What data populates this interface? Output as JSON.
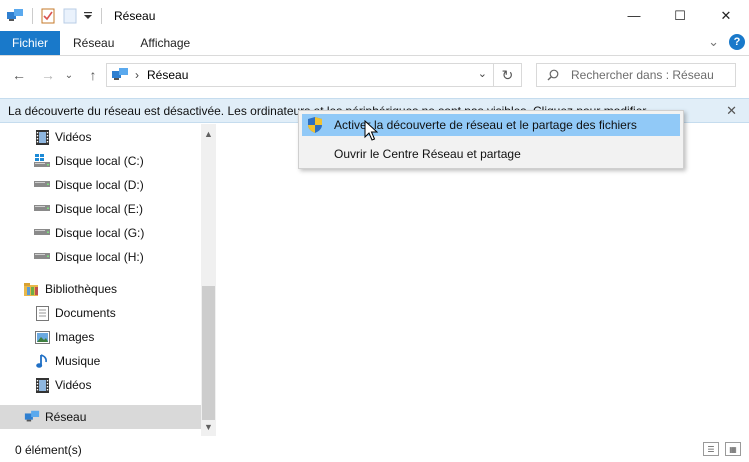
{
  "window": {
    "title": "Réseau",
    "minimize_glyph": "—",
    "maximize_glyph": "☐",
    "close_glyph": "✕"
  },
  "ribbon": {
    "tabs": [
      "Fichier",
      "Réseau",
      "Affichage"
    ],
    "expand_glyph": "⌄",
    "help_glyph": "?"
  },
  "navbar": {
    "back_glyph": "←",
    "forward_glyph": "→",
    "recent_glyph": "⌄",
    "up_glyph": "↑",
    "breadcrumb_separator": "›",
    "address": "Réseau",
    "address_dropdown_glyph": "⌄",
    "refresh_glyph": "↻",
    "search_placeholder": "Rechercher dans : Réseau",
    "search_glyph": "⚲"
  },
  "infobar": {
    "message": "La découverte du réseau est désactivée. Les ordinateurs et les périphériques ne sont pas visibles. Cliquez pour modifier...",
    "close_glyph": "✕"
  },
  "nav_pane": {
    "items": [
      {
        "label": "Vidéos",
        "icon": "video-icon"
      },
      {
        "label": "Disque local  (C:)",
        "icon": "windows-drive-icon"
      },
      {
        "label": "Disque local (D:)",
        "icon": "drive-icon"
      },
      {
        "label": "Disque local (E:)",
        "icon": "drive-icon"
      },
      {
        "label": "Disque local (G:)",
        "icon": "drive-icon"
      },
      {
        "label": "Disque local (H:)",
        "icon": "drive-icon"
      },
      {
        "label": "Bibliothèques",
        "icon": "libraries-icon"
      },
      {
        "label": "Documents",
        "icon": "documents-icon"
      },
      {
        "label": "Images",
        "icon": "pictures-icon"
      },
      {
        "label": "Musique",
        "icon": "music-icon"
      },
      {
        "label": "Vidéos",
        "icon": "video-icon"
      },
      {
        "label": "Réseau",
        "icon": "network-icon",
        "selected": true
      }
    ],
    "scroll_up_glyph": "▲",
    "scroll_down_glyph": "▼"
  },
  "context_menu": {
    "items": [
      {
        "label": "Activer la découverte de réseau et le partage des fichiers",
        "highlighted": true,
        "icon": "uac-shield-icon"
      },
      {
        "label": "Ouvrir le Centre Réseau et partage",
        "highlighted": false
      }
    ]
  },
  "status": {
    "item_count": "0 élément(s)"
  },
  "colors": {
    "accent": "#1979ca",
    "infobar_bg": "#e1eef8",
    "menu_highlight": "#91c9f7",
    "selected_item_bg": "#d9d9d9"
  }
}
